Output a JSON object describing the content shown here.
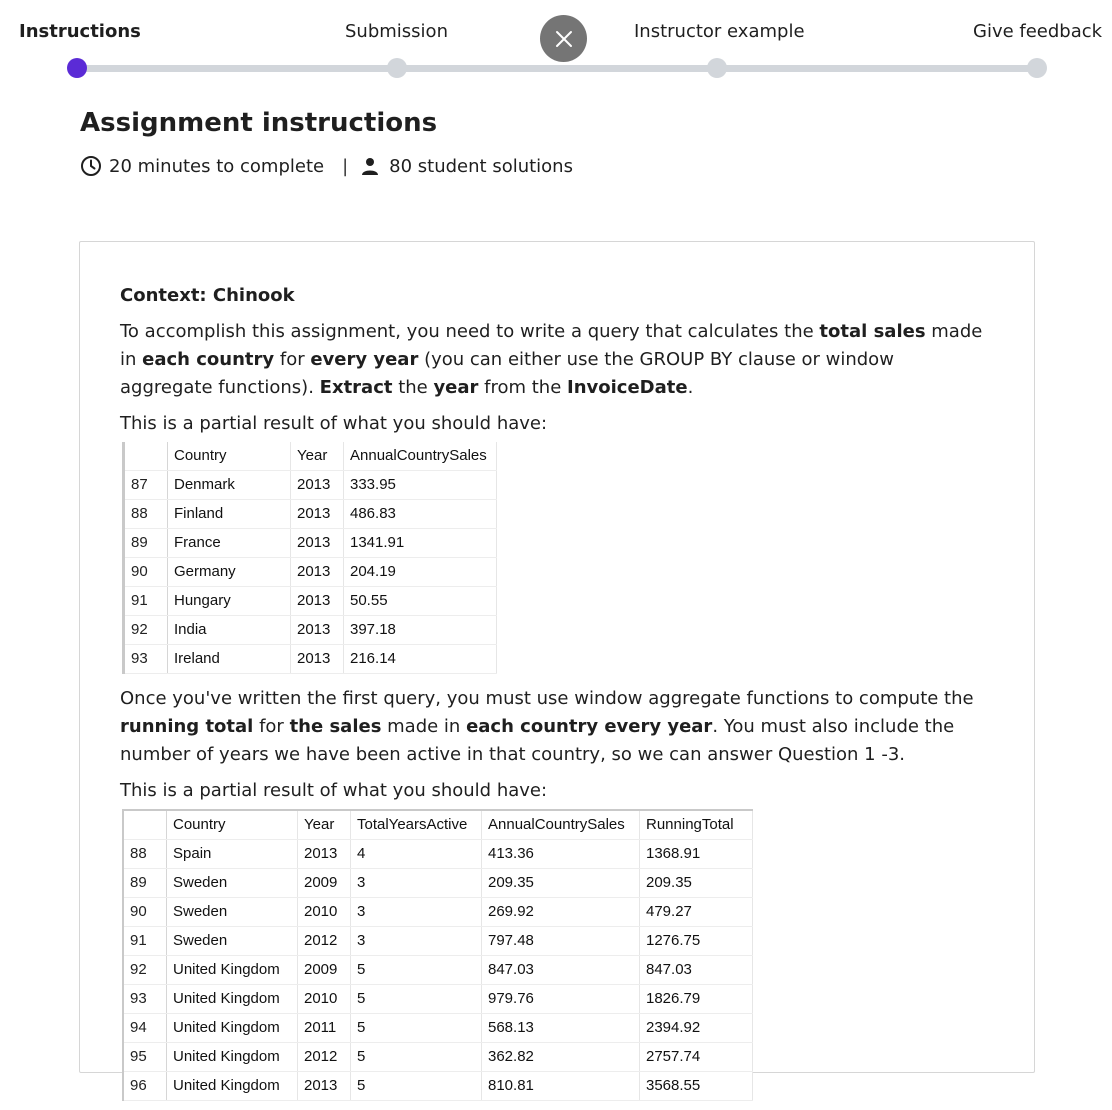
{
  "stepper": {
    "steps": [
      {
        "label": "Instructions",
        "active": true
      },
      {
        "label": "Submission",
        "active": false
      },
      {
        "label": "Instructor example",
        "active": false
      },
      {
        "label": "Give feedback",
        "active": false
      }
    ],
    "accent_color": "#5b2bd6",
    "inactive_color": "#d2d6db",
    "close_icon": "close-icon"
  },
  "header": {
    "title": "Assignment instructions",
    "duration": "20 minutes to complete",
    "separator": "|",
    "solutions": "80 student solutions"
  },
  "content": {
    "context_heading": "Context: Chinook",
    "para1": [
      {
        "t": "To accomplish this assignment, you need to write a query that calculates the ",
        "b": false
      },
      {
        "t": "total sales",
        "b": true
      },
      {
        "t": " made in ",
        "b": false
      },
      {
        "t": "each country",
        "b": true
      },
      {
        "t": " for ",
        "b": false
      },
      {
        "t": "every year",
        "b": true
      },
      {
        "t": " (you can either use the GROUP BY clause or window aggregate functions). ",
        "b": false
      },
      {
        "t": "Extract",
        "b": true
      },
      {
        "t": " the ",
        "b": false
      },
      {
        "t": "year",
        "b": true
      },
      {
        "t": " from the ",
        "b": false
      },
      {
        "t": "InvoiceDate",
        "b": true
      },
      {
        "t": ".",
        "b": false
      }
    ],
    "partial_label_1": "This is a partial result of what you should have:",
    "table1": {
      "columns": [
        "",
        "Country",
        "Year",
        "AnnualCountrySales"
      ],
      "rows": [
        [
          "87",
          "Denmark",
          "2013",
          "333.95"
        ],
        [
          "88",
          "Finland",
          "2013",
          "486.83"
        ],
        [
          "89",
          "France",
          "2013",
          "1341.91"
        ],
        [
          "90",
          "Germany",
          "2013",
          "204.19"
        ],
        [
          "91",
          "Hungary",
          "2013",
          "50.55"
        ],
        [
          "92",
          "India",
          "2013",
          "397.18"
        ],
        [
          "93",
          "Ireland",
          "2013",
          "216.14"
        ]
      ]
    },
    "para2": [
      {
        "t": "Once you've written the first query, you must use window aggregate functions to compute the ",
        "b": false
      },
      {
        "t": "running total",
        "b": true
      },
      {
        "t": " for ",
        "b": false
      },
      {
        "t": "the sales",
        "b": true
      },
      {
        "t": " made in ",
        "b": false
      },
      {
        "t": "each country every year",
        "b": true
      },
      {
        "t": ". You must also include the number of years we have been active in that country, so we can answer Question 1 -3.",
        "b": false
      }
    ],
    "partial_label_2": "This is a partial result of what you should have:",
    "table2": {
      "columns": [
        "",
        "Country",
        "Year",
        "TotalYearsActive",
        "AnnualCountrySales",
        "RunningTotal"
      ],
      "rows": [
        [
          "88",
          "Spain",
          "2013",
          "4",
          "413.36",
          "1368.91"
        ],
        [
          "89",
          "Sweden",
          "2009",
          "3",
          "209.35",
          "209.35"
        ],
        [
          "90",
          "Sweden",
          "2010",
          "3",
          "269.92",
          "479.27"
        ],
        [
          "91",
          "Sweden",
          "2012",
          "3",
          "797.48",
          "1276.75"
        ],
        [
          "92",
          "United Kingdom",
          "2009",
          "5",
          "847.03",
          "847.03"
        ],
        [
          "93",
          "United Kingdom",
          "2010",
          "5",
          "979.76",
          "1826.79"
        ],
        [
          "94",
          "United Kingdom",
          "2011",
          "5",
          "568.13",
          "2394.92"
        ],
        [
          "95",
          "United Kingdom",
          "2012",
          "5",
          "362.82",
          "2757.74"
        ],
        [
          "96",
          "United Kingdom",
          "2013",
          "5",
          "810.81",
          "3568.55"
        ]
      ]
    }
  }
}
